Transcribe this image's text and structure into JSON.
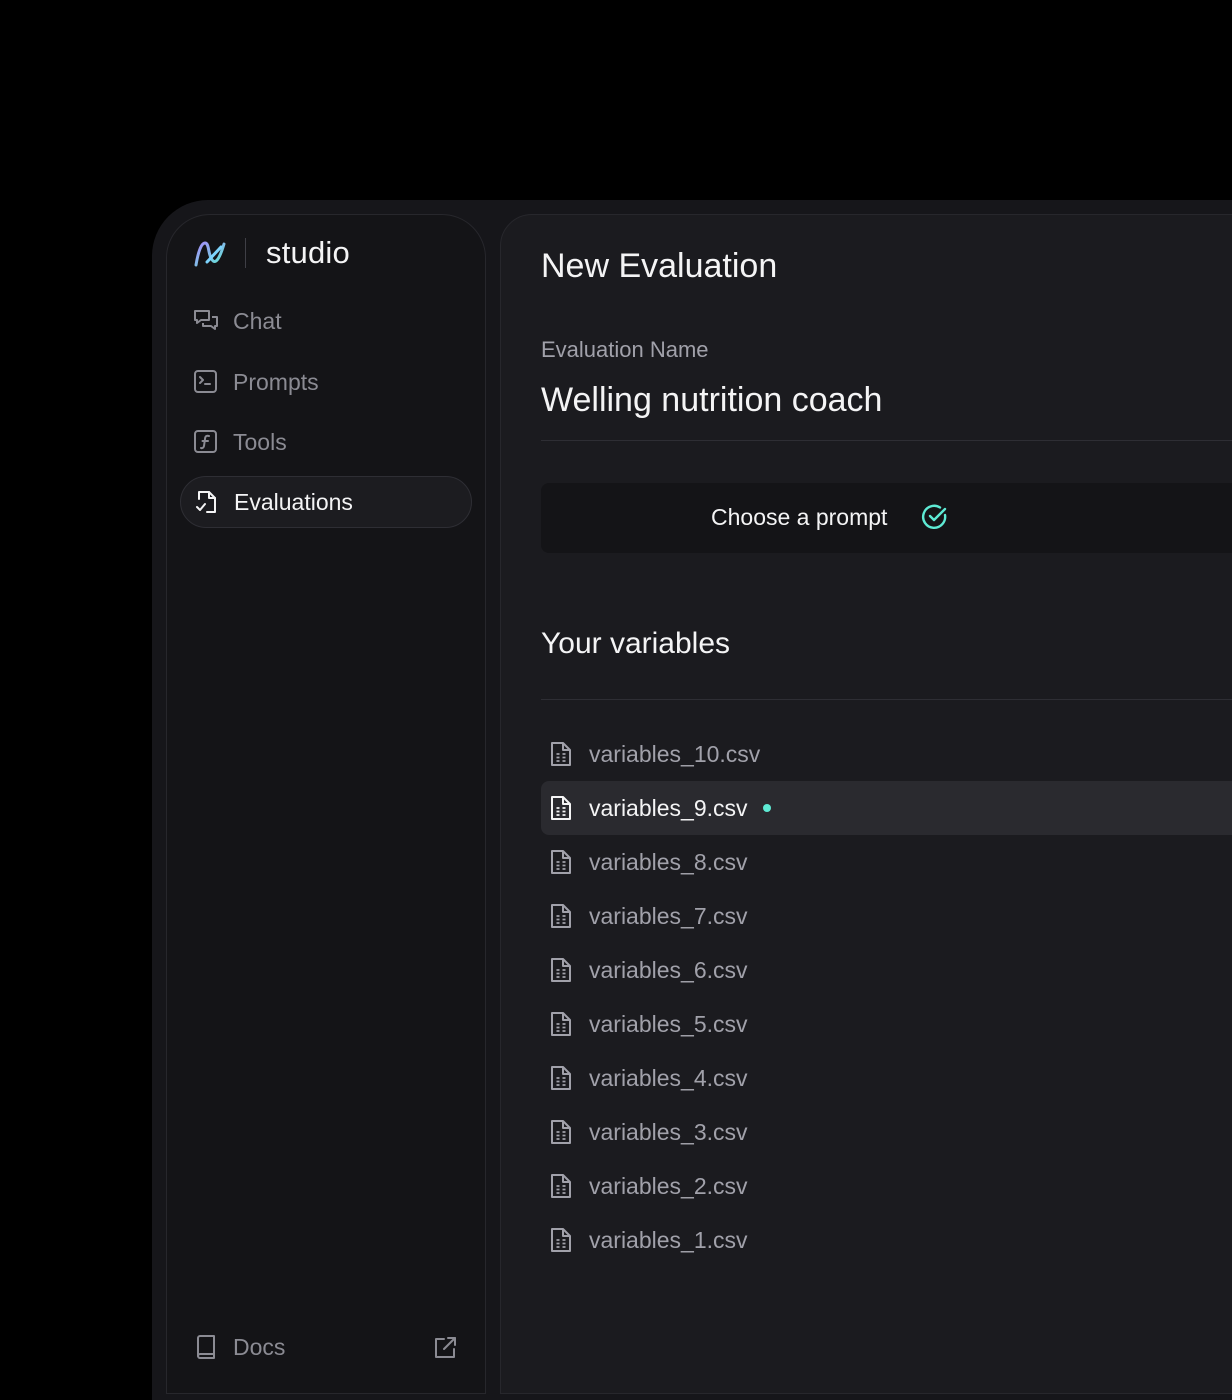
{
  "app": {
    "brand_name": "studio",
    "accent_color": "#5eead4"
  },
  "sidebar": {
    "items": [
      {
        "label": "Chat",
        "icon": "chat-bubbles-icon",
        "active": false
      },
      {
        "label": "Prompts",
        "icon": "terminal-icon",
        "active": false
      },
      {
        "label": "Tools",
        "icon": "function-icon",
        "active": false
      },
      {
        "label": "Evaluations",
        "icon": "file-check-icon",
        "active": true
      }
    ],
    "footer": {
      "label": "Docs",
      "icon": "book-icon",
      "external_icon": "external-link-icon"
    }
  },
  "main": {
    "title": "New Evaluation",
    "evaluation_name": {
      "label": "Evaluation Name",
      "value": "Welling nutrition coach"
    },
    "prompt_button": {
      "label": "Choose a prompt",
      "icon": "check-circle-icon"
    },
    "variables": {
      "title": "Your variables",
      "files": [
        {
          "name": "variables_10.csv",
          "selected": false
        },
        {
          "name": "variables_9.csv",
          "selected": true
        },
        {
          "name": "variables_8.csv",
          "selected": false
        },
        {
          "name": "variables_7.csv",
          "selected": false
        },
        {
          "name": "variables_6.csv",
          "selected": false
        },
        {
          "name": "variables_5.csv",
          "selected": false
        },
        {
          "name": "variables_4.csv",
          "selected": false
        },
        {
          "name": "variables_3.csv",
          "selected": false
        },
        {
          "name": "variables_2.csv",
          "selected": false
        },
        {
          "name": "variables_1.csv",
          "selected": false
        }
      ]
    }
  }
}
